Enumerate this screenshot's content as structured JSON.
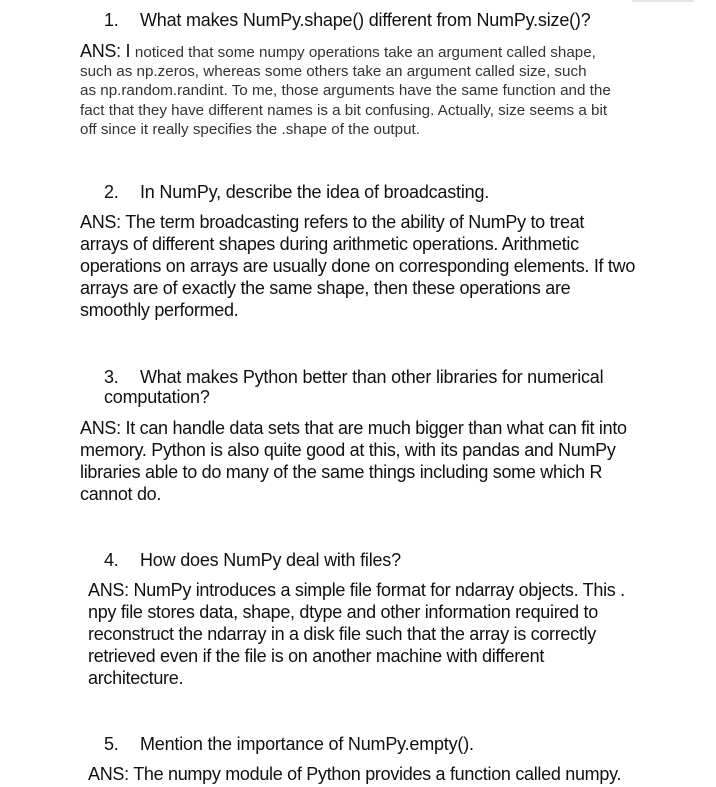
{
  "questions": [
    {
      "number": "1.",
      "question": "What makes NumPy.shape() different from NumPy.size()?",
      "answer_lead": "ANS: I ",
      "answer_lines": [
        "noticed that some numpy operations take an argument called shape,",
        "such as np.zeros, whereas some others take an argument called size, such",
        "as np.random.randint. To me, those arguments have the same function and the",
        "fact that they have different names is a bit confusing. Actually, size seems a bit",
        "off since it really specifies the .shape of the output."
      ]
    },
    {
      "number": "2.",
      "question": "In NumPy, describe the idea of broadcasting.",
      "answer_lines": [
        "ANS: The term broadcasting refers to the ability of NumPy to treat",
        "arrays of different shapes during arithmetic operations. Arithmetic",
        "operations on arrays are usually done on corresponding elements. If two",
        "arrays are of exactly the same shape, then these operations are",
        "smoothly performed."
      ]
    },
    {
      "number": "3.",
      "question_lines": [
        "What makes Python better than other libraries for numerical",
        "computation?"
      ],
      "answer_lines": [
        "ANS: It can handle data sets that are much bigger than what can fit into",
        "memory. Python is also quite good at this, with its pandas and NumPy",
        "libraries able to do many of the same things including some which R",
        "cannot do."
      ]
    },
    {
      "number": "4.",
      "question": "How does NumPy deal with files?",
      "answer_lines": [
        "ANS: NumPy introduces a simple file format for ndarray objects. This .",
        "npy file stores data, shape, dtype and other information required to",
        "reconstruct the ndarray in a disk file such that the array is correctly",
        "retrieved even if the file is on another machine with different",
        "architecture."
      ]
    },
    {
      "number": "5.",
      "question": "Mention the importance of NumPy.empty().",
      "answer_lines": [
        "ANS: The numpy module of Python provides a function called numpy."
      ]
    }
  ]
}
